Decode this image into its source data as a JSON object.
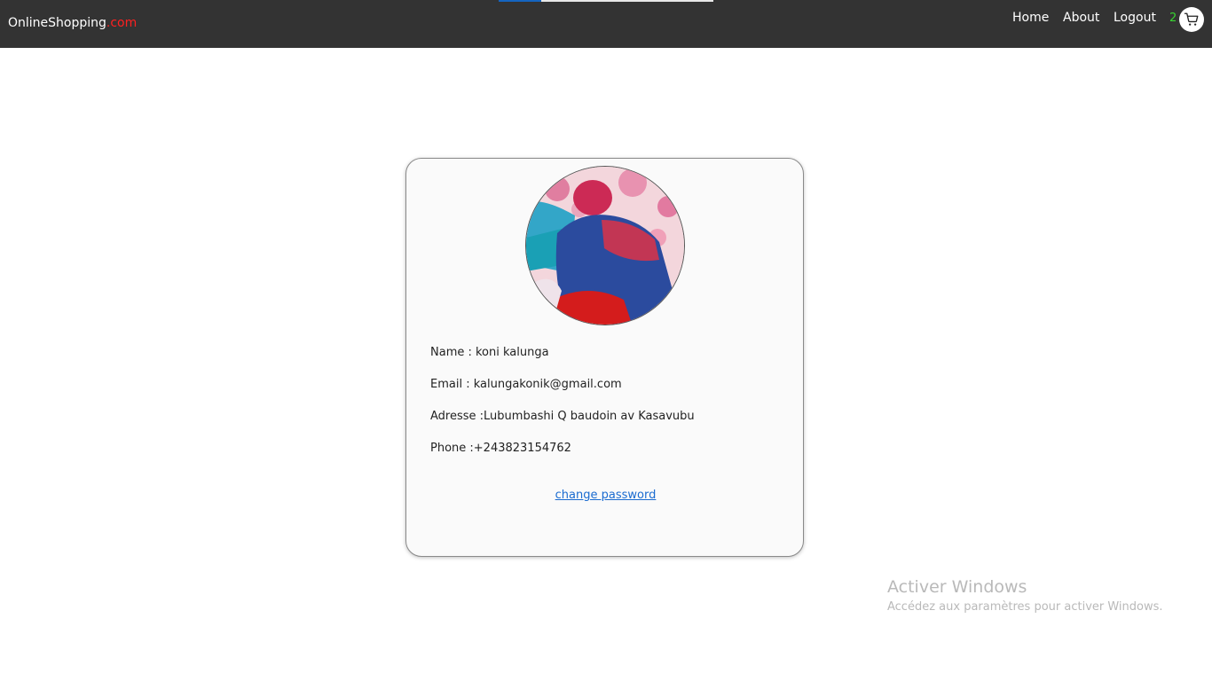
{
  "navbar": {
    "brand_name": "OnlineShopping",
    "brand_tld": ".com",
    "links": [
      {
        "label": "Home"
      },
      {
        "label": "About"
      },
      {
        "label": "Logout"
      }
    ],
    "cart_count": "2",
    "cart_icon": "cart-icon",
    "page_load_progress": 0.2
  },
  "profile": {
    "avatar_icon": "profile-photo",
    "name": "Name : koni kalunga",
    "email": "Email : kalungakonik@gmail.com",
    "address": "Adresse :Lubumbashi Q baudoin av Kasavubu",
    "phone": "Phone :+243823154762",
    "change_password_label": "change password"
  },
  "watermark": {
    "title": "Activer Windows",
    "subtitle": "Accédez aux paramètres pour activer Windows."
  },
  "colors": {
    "navbar_bg": "#333333",
    "brand_tld": "#ff2020",
    "cart_count": "#38d430",
    "link_blue": "#1a6bd0",
    "progress": "#1565c0"
  }
}
